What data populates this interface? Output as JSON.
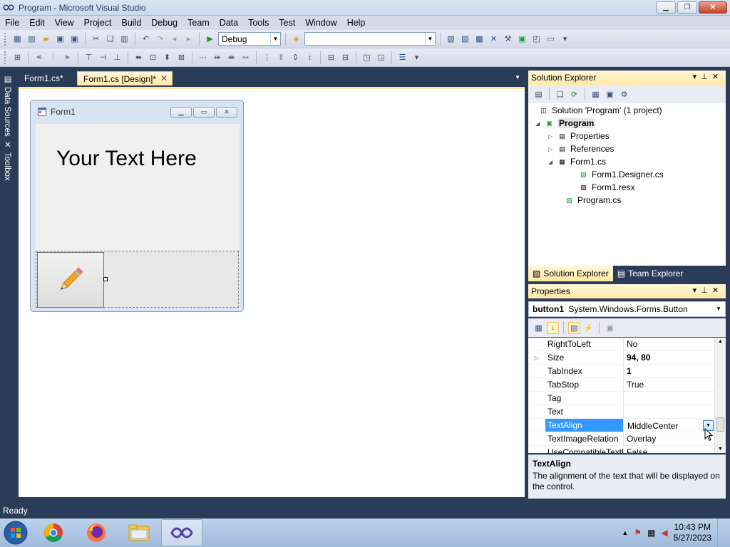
{
  "window": {
    "title": "Program - Microsoft Visual Studio"
  },
  "menu": [
    "File",
    "Edit",
    "View",
    "Project",
    "Build",
    "Debug",
    "Team",
    "Data",
    "Tools",
    "Test",
    "Window",
    "Help"
  ],
  "toolbar": {
    "config": "Debug",
    "platform": ""
  },
  "side_tabs": [
    "Data Sources",
    "Toolbox"
  ],
  "doc_tabs": [
    {
      "label": "Form1.cs*",
      "active": false
    },
    {
      "label": "Form1.cs [Design]*",
      "active": true
    }
  ],
  "designer": {
    "form_title": "Form1",
    "label_text": "Your Text Here"
  },
  "solution_explorer": {
    "title": "Solution Explorer",
    "tree": [
      {
        "label": "Solution 'Program' (1 project)",
        "indent": 0,
        "toggle": "",
        "icon": "solution"
      },
      {
        "label": "Program",
        "indent": 1,
        "toggle": "◢",
        "icon": "project",
        "bold": true
      },
      {
        "label": "Properties",
        "indent": 2,
        "toggle": "▷",
        "icon": "folder"
      },
      {
        "label": "References",
        "indent": 2,
        "toggle": "▷",
        "icon": "folder"
      },
      {
        "label": "Form1.cs",
        "indent": 2,
        "toggle": "◢",
        "icon": "form"
      },
      {
        "label": "Form1.Designer.cs",
        "indent": 3,
        "toggle": "",
        "icon": "cs"
      },
      {
        "label": "Form1.resx",
        "indent": 3,
        "toggle": "",
        "icon": "resx"
      },
      {
        "label": "Program.cs",
        "indent": 2,
        "toggle": "",
        "icon": "cs"
      }
    ],
    "bottom_tabs": [
      "Solution Explorer",
      "Team Explorer"
    ]
  },
  "properties": {
    "title": "Properties",
    "object_name": "button1",
    "object_type": "System.Windows.Forms.Button",
    "rows": [
      {
        "name": "RightToLeft",
        "value": "No",
        "bold": false,
        "expand": ""
      },
      {
        "name": "Size",
        "value": "94, 80",
        "bold": true,
        "expand": "▷"
      },
      {
        "name": "TabIndex",
        "value": "1",
        "bold": true,
        "expand": ""
      },
      {
        "name": "TabStop",
        "value": "True",
        "bold": false,
        "expand": ""
      },
      {
        "name": "Tag",
        "value": "",
        "bold": false,
        "expand": ""
      },
      {
        "name": "Text",
        "value": "",
        "bold": false,
        "expand": ""
      },
      {
        "name": "TextAlign",
        "value": "MiddleCenter",
        "bold": false,
        "expand": "",
        "selected": true
      },
      {
        "name": "TextImageRelation",
        "value": "Overlay",
        "bold": false,
        "expand": ""
      },
      {
        "name": "UseCompatibleTextRendering",
        "value": "False",
        "bold": false,
        "expand": ""
      }
    ],
    "desc_title": "TextAlign",
    "desc_text": "The alignment of the text that will be displayed on the control."
  },
  "status": {
    "text": "Ready"
  },
  "taskbar": {
    "time": "10:43 PM",
    "date": "5/27/2023"
  }
}
